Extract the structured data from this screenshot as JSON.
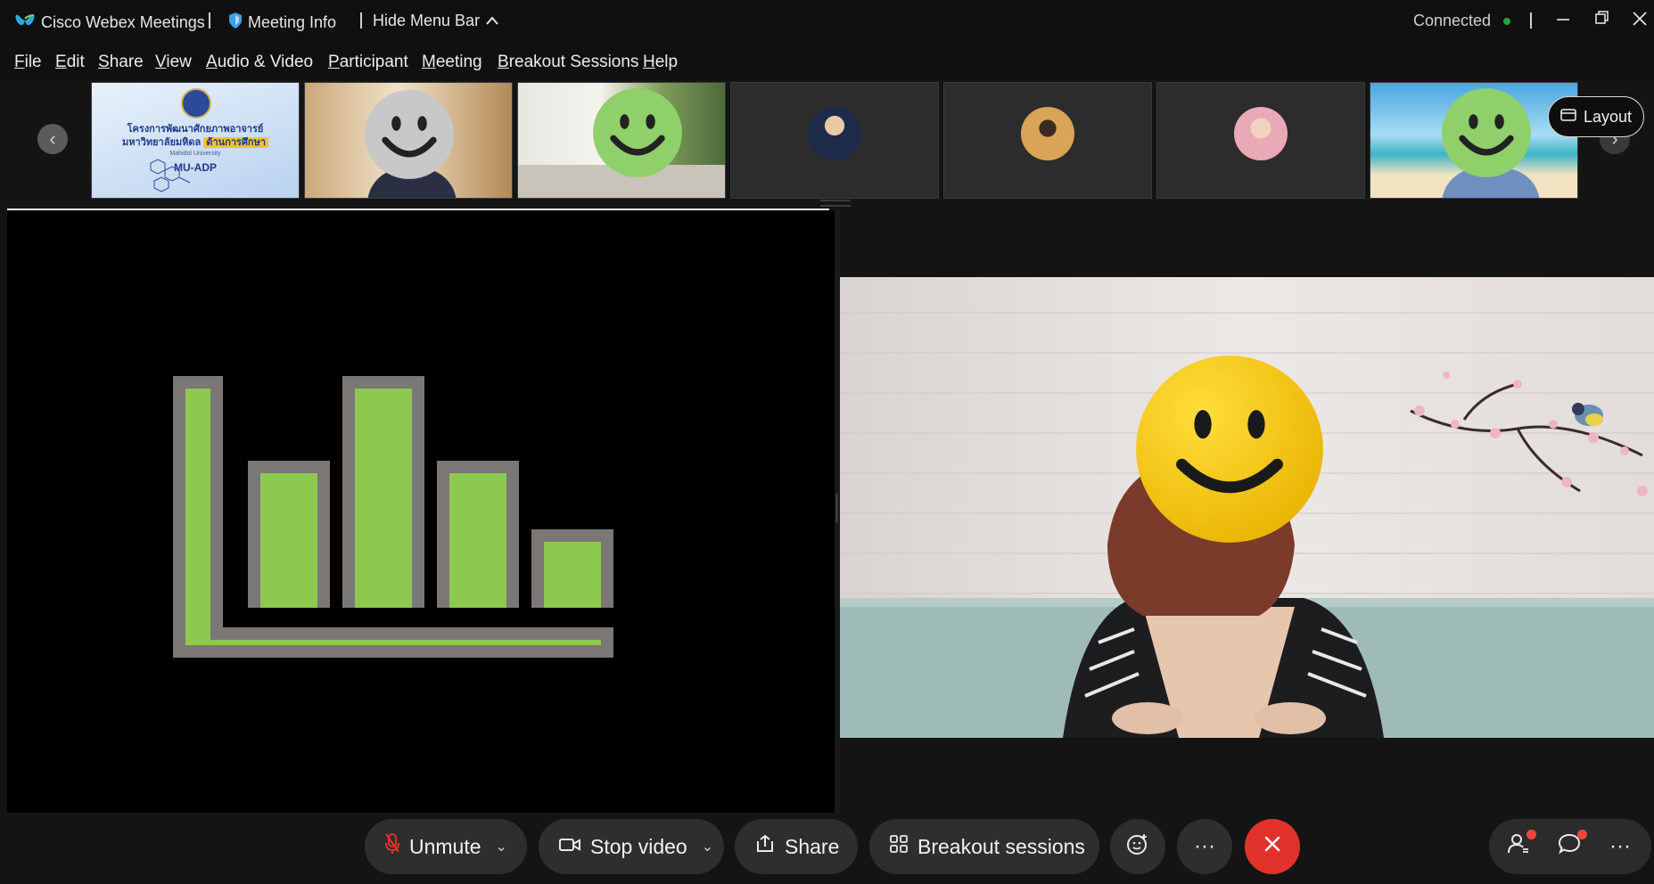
{
  "titlebar": {
    "app_name": "Cisco Webex Meetings",
    "meeting_info": "Meeting Info",
    "hide_menu_bar": "Hide Menu Bar",
    "status": "Connected",
    "status_color": "#2ea043"
  },
  "menu": {
    "items": [
      "File",
      "Edit",
      "Share",
      "View",
      "Audio & Video",
      "Participant",
      "Meeting",
      "Breakout Sessions",
      "Help"
    ]
  },
  "filmstrip": {
    "layout_label": "Layout",
    "slide_tile": {
      "title_line1": "โครงการพัฒนาศักยภาพอาจารย์",
      "title_line2": "มหาวิทยาลัยมหิดล",
      "highlight": "ด้านการศึกษา",
      "university": "Mahidol University",
      "program": "MU-ADP"
    }
  },
  "controls": {
    "unmute_label": "Unmute",
    "stop_video_label": "Stop video",
    "share_label": "Share",
    "breakout_label": "Breakout sessions",
    "end_color": "#e0322b"
  },
  "icons": [
    "webex-logo-icon",
    "shield-icon",
    "chevron-up-icon",
    "minimize-icon",
    "restore-icon",
    "close-icon",
    "mic-muted-icon",
    "video-camera-icon",
    "share-icon",
    "breakout-icon",
    "reaction-icon",
    "more-icon",
    "end-call-icon",
    "participants-icon",
    "chat-icon",
    "layout-icon"
  ]
}
